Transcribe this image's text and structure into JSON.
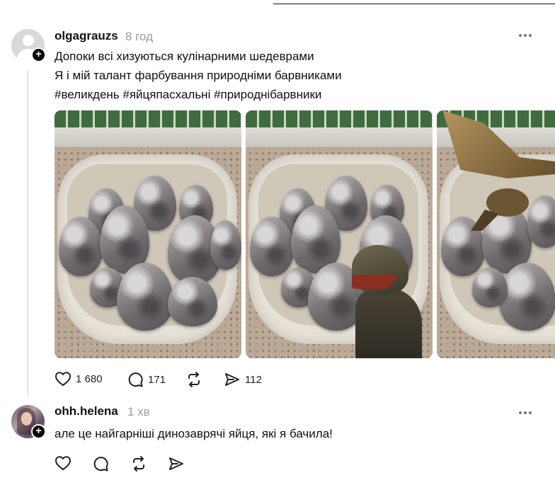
{
  "post": {
    "username": "olgagrauzs",
    "time": "8 год",
    "lines": [
      "Допоки всі хизуються кулінарними шедеврами",
      "Я і мій талант фарбування природніми барвниками",
      "#великдень #яйцяпасхальні #природнібарвники"
    ],
    "photos": [
      {
        "alt": "photo-eggs-bowl"
      },
      {
        "alt": "photo-eggs-raptor"
      },
      {
        "alt": "photo-eggs-pterodactyl"
      }
    ],
    "actions": {
      "likes": "1 680",
      "replies": "171",
      "reposts": "",
      "shares": "112"
    },
    "follow_symbol": "+"
  },
  "comment": {
    "username": "ohh.helena",
    "time": "1 хв",
    "text": "але це найгарніші динозаврячі яйця, які я бачила!",
    "follow_symbol": "+"
  },
  "icons": {
    "like": "heart-icon",
    "reply": "speech-bubble-icon",
    "repost": "repost-arrows-icon",
    "share": "paper-plane-icon",
    "more": "more-dots-icon"
  },
  "colors": {
    "text": "#101010",
    "muted": "#9b9b9b",
    "thread_line": "#e2e2e2"
  }
}
